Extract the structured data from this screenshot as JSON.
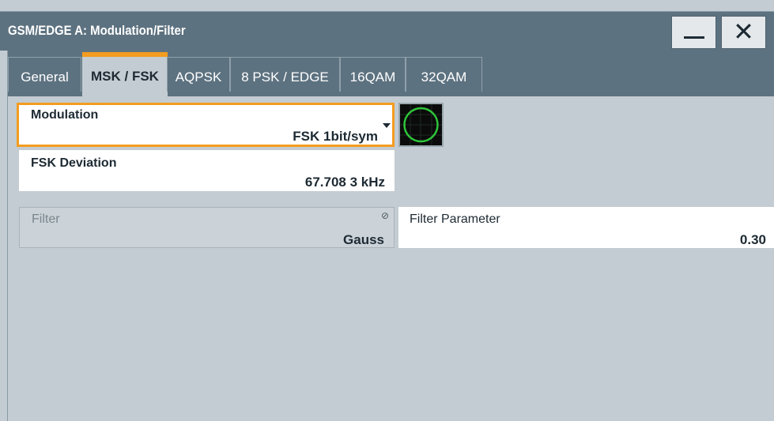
{
  "window": {
    "title": "GSM/EDGE A: Modulation/Filter"
  },
  "titlebar": {
    "minimize_label": "",
    "close_label": "✕"
  },
  "tabs": [
    {
      "label": "General",
      "active": false
    },
    {
      "label": "MSK / FSK",
      "active": true
    },
    {
      "label": "AQPSK",
      "active": false
    },
    {
      "label": "8 PSK / EDGE",
      "active": false
    },
    {
      "label": "16QAM",
      "active": false
    },
    {
      "label": "32QAM",
      "active": false
    }
  ],
  "modulation": {
    "label": "Modulation",
    "value": "FSK 1bit/sym"
  },
  "fsk_deviation": {
    "label": "FSK Deviation",
    "value": "67.708 3 kHz"
  },
  "filter": {
    "label": "Filter",
    "value": "Gauss"
  },
  "filter_parameter": {
    "label": "Filter Parameter",
    "value": "0.30"
  },
  "colors": {
    "accent": "#f39c1f",
    "titlebar": "#5d7280",
    "panel": "#c3ccd2",
    "constellation": "#2ec43a"
  }
}
